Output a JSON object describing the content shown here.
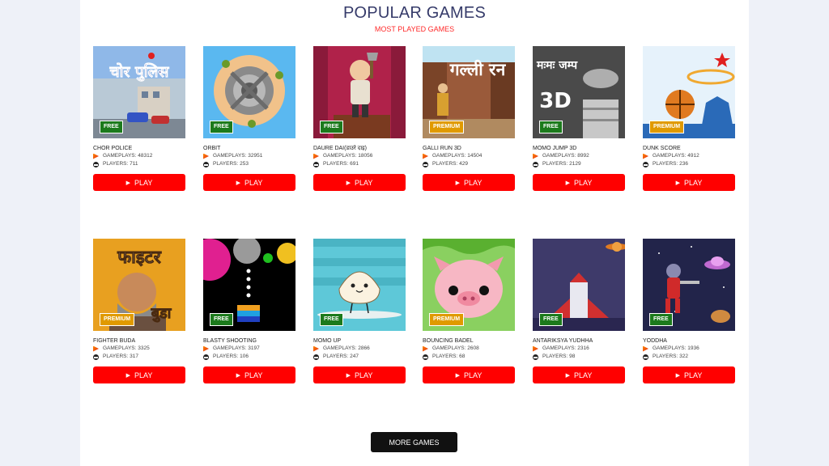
{
  "section": {
    "title": "POPULAR GAMES",
    "subtitle": "MOST PLAYED GAMES"
  },
  "labels": {
    "play": "PLAY"
  },
  "games": [
    {
      "name": "CHOR POLICE",
      "gameplays": "GAMEPLAYS: 48312",
      "players": "PLAYERS: 711",
      "badge": "FREE",
      "art_text": "चोर पुलिस",
      "icon": "chor-police-thumbnail"
    },
    {
      "name": "ORBIT",
      "gameplays": "GAMEPLAYS: 32951",
      "players": "PLAYERS: 253",
      "badge": "FREE",
      "icon": "orbit-thumbnail"
    },
    {
      "name": "DAURE DAI(डाउरे दाइ)",
      "gameplays": "GAMEPLAYS: 18056",
      "players": "PLAYERS: 691",
      "badge": "FREE",
      "icon": "daure-dai-thumbnail"
    },
    {
      "name": "GALLI RUN 3D",
      "gameplays": "GAMEPLAYS: 14504",
      "players": "PLAYERS: 429",
      "badge": "PREMIUM",
      "art_text": "गल्ली रन",
      "icon": "galli-run-thumbnail"
    },
    {
      "name": "MOMO JUMP 3D",
      "gameplays": "GAMEPLAYS: 8992",
      "players": "PLAYERS: 2129",
      "badge": "FREE",
      "art_text": "मःमः जम्प",
      "art_text2": "3D",
      "icon": "momo-jump-thumbnail"
    },
    {
      "name": "DUNK SCORE",
      "gameplays": "GAMEPLAYS: 4912",
      "players": "PLAYERS: 236",
      "badge": "PREMIUM",
      "icon": "dunk-score-thumbnail"
    },
    {
      "name": "FIGHTER BUDA",
      "gameplays": "GAMEPLAYS: 3325",
      "players": "PLAYERS: 317",
      "badge": "PREMIUM",
      "art_text": "फाइटर",
      "art_text2": "बुडा",
      "icon": "fighter-buda-thumbnail"
    },
    {
      "name": "BLASTY SHOOTING",
      "gameplays": "GAMEPLAYS: 3197",
      "players": "PLAYERS: 106",
      "badge": "FREE",
      "icon": "blasty-shooting-thumbnail"
    },
    {
      "name": "MOMO UP",
      "gameplays": "GAMEPLAYS: 2866",
      "players": "PLAYERS: 247",
      "badge": "FREE",
      "icon": "momo-up-thumbnail"
    },
    {
      "name": "BOUNCING BADEL",
      "gameplays": "GAMEPLAYS: 2608",
      "players": "PLAYERS: 68",
      "badge": "PREMIUM",
      "icon": "bouncing-badel-thumbnail"
    },
    {
      "name": "ANTARIKSYA YUDHHA",
      "gameplays": "GAMEPLAYS: 2316",
      "players": "PLAYERS: 98",
      "badge": "FREE",
      "icon": "antariksya-yudhha-thumbnail"
    },
    {
      "name": "YODDHA",
      "gameplays": "GAMEPLAYS: 1936",
      "players": "PLAYERS: 322",
      "badge": "FREE",
      "icon": "yoddha-thumbnail"
    }
  ],
  "more_button": "MORE GAMES",
  "colors": {
    "accent": "#ff0000",
    "title": "#363b6a",
    "free": "#1c7a1c",
    "premium": "#e09a00",
    "more_bg": "#111111"
  }
}
